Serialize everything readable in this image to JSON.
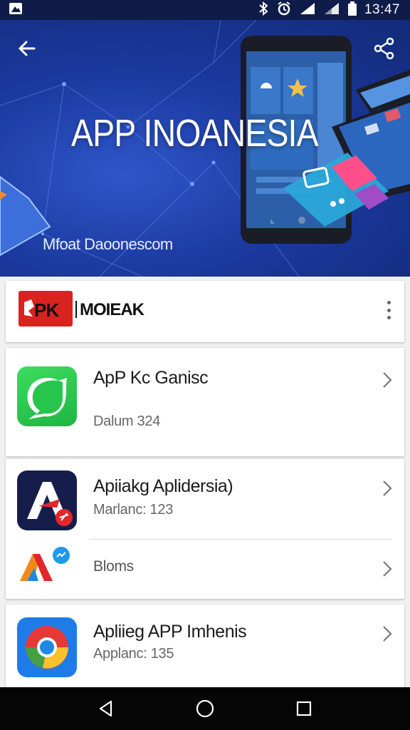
{
  "status_bar": {
    "time": "13:47"
  },
  "hero": {
    "title": "APP INOANESIA",
    "subtitle": "Mfoat Daoonescom"
  },
  "brand": {
    "logo_text": "PK",
    "name": "MOIEAK"
  },
  "apps": [
    {
      "title": "ApP Kc Ganisc",
      "subtitle": "Dalum 324",
      "icon": "chat-bubble-icon",
      "color": "#2ecc4f"
    },
    {
      "title": "Apiiakg Aplidersia)",
      "subtitle": "Marlanc: 123",
      "icon": "letter-a-icon",
      "color": "#151e4a"
    },
    {
      "title": "",
      "subtitle": "Bloms",
      "icon": "colorful-a-icon",
      "color": "#ffffff"
    },
    {
      "title": "Apliieg APP Imhenis",
      "subtitle": "Applanc: 135",
      "icon": "chrome-icon",
      "color": "#1e7be8"
    }
  ],
  "colors": {
    "status_bar": "#0f1c4a",
    "hero_blue": "#1b3aa0",
    "brand_red": "#d8231f",
    "nav_bar": "#050505"
  }
}
